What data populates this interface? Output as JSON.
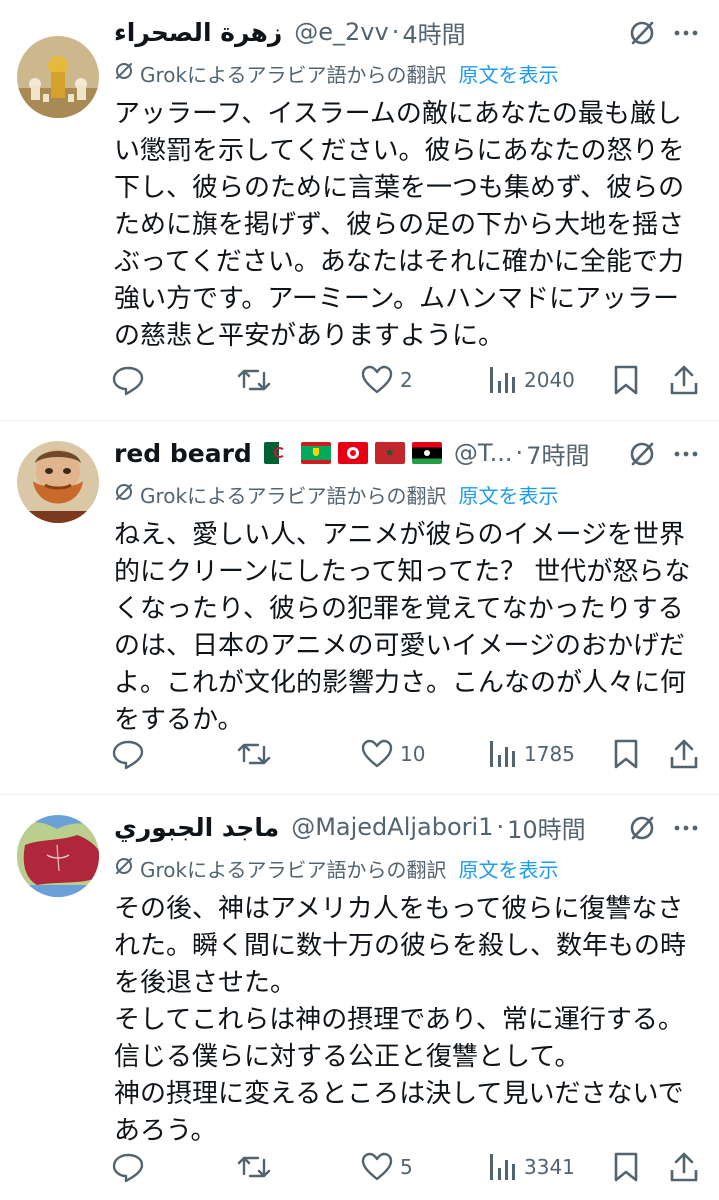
{
  "colors": {
    "accent": "#1d9bf0",
    "muted": "#536471",
    "text": "#0f1419"
  },
  "tweets": [
    {
      "name": "زهرة الصحراء",
      "handle": "@e_2vv",
      "separator": "·",
      "time": "4時間",
      "translation_note": "Grokによるアラビア語からの翻訳",
      "show_original": "原文を表示",
      "body": "アッラーフ、イスラームの敵にあなたの最も厳しい懲罰を示してください。彼らにあなたの怒りを下し、彼らのために言葉を一つも集めず、彼らのために旗を掲げず、彼らの足の下から大地を揺さぶってください。あなたはそれに確かに全能で力強い方です。アーミーン。ムハンマドにアッラーの慈悲と平安がありますように。",
      "reply_count": "",
      "retweet_count": "",
      "like_count": "2",
      "view_count": "2040"
    },
    {
      "name": "red beard",
      "flags": [
        "algeria-flag",
        "mauritania-flag",
        "tunisia-flag",
        "morocco-flag",
        "libya-flag"
      ],
      "handle": "@T...",
      "separator": "·",
      "time": "7時間",
      "translation_note": "Grokによるアラビア語からの翻訳",
      "show_original": "原文を表示",
      "body": "ねえ、愛しい人、アニメが彼らのイメージを世界的にクリーンにしたって知ってた？ 世代が怒らなくなったり、彼らの犯罪を覚えてなかったりするのは、日本のアニメの可愛いイメージのおかげだよ。これが文化的影響力さ。こんなのが人々に何をするか。",
      "reply_count": "",
      "retweet_count": "",
      "like_count": "10",
      "view_count": "1785"
    },
    {
      "name": "ماجد الجبوري",
      "handle": "@MajedAljabori1",
      "separator": "·",
      "time": "10時間",
      "translation_note": "Grokによるアラビア語からの翻訳",
      "show_original": "原文を表示",
      "body": "その後、神はアメリカ人をもって彼らに復讐なされた。瞬く間に数十万の彼らを殺し、数年もの時を後退させた。\nそしてこれらは神の摂理であり、常に運行する。\n信じる僕らに対する公正と復讐として。\n神の摂理に変えるところは決して見いださないであろう。",
      "reply_count": "",
      "retweet_count": "",
      "like_count": "5",
      "view_count": "3341"
    }
  ],
  "icons": {
    "grok": "grok-slash-icon",
    "more": "more-dots-icon",
    "translate": "grok-translate-icon",
    "reply": "reply-icon",
    "retweet": "retweet-icon",
    "like": "like-heart-icon",
    "views": "views-bar-icon",
    "bookmark": "bookmark-icon",
    "share": "share-icon"
  }
}
